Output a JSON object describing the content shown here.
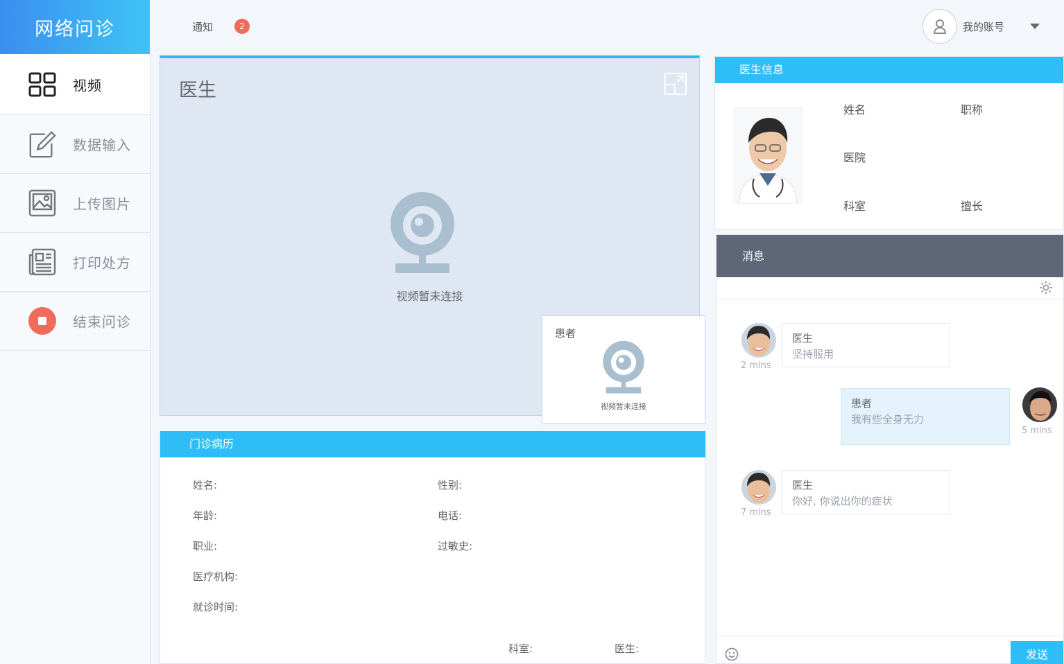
{
  "app": {
    "title": "网络问诊"
  },
  "topbar": {
    "notice_label": "通知",
    "notice_count": "2",
    "account_label": "我的账号"
  },
  "sidebar": {
    "items": [
      {
        "label": "视频",
        "icon": "grid-icon"
      },
      {
        "label": "数据输入",
        "icon": "edit-icon"
      },
      {
        "label": "上传图片",
        "icon": "image-icon"
      },
      {
        "label": "打印处方",
        "icon": "newspaper-icon"
      },
      {
        "label": "结束问诊",
        "icon": "stop-icon"
      }
    ]
  },
  "video": {
    "main_title": "医生",
    "main_status": "视频暂未连接",
    "small_title": "患者",
    "small_status": "视频暂未连接"
  },
  "record": {
    "title": "门诊病历",
    "name_label": "姓名:",
    "gender_label": "性别:",
    "age_label": "年龄:",
    "phone_label": "电话:",
    "job_label": "职业:",
    "allergy_label": "过敏史:",
    "org_label": "医疗机构:",
    "time_label": "就诊时间:",
    "dept_label": "科室:",
    "doctor_label": "医生:"
  },
  "doctor_info": {
    "title": "医生信息",
    "name_label": "姓名",
    "title_label": "职称",
    "hospital_label": "医院",
    "dept_label": "科室",
    "specialty_label": "擅长"
  },
  "messages": {
    "title": "消息",
    "send_label": "发送",
    "items": [
      {
        "sender": "医生",
        "text": "坚持服用",
        "time": "2 mins"
      },
      {
        "sender": "患者",
        "text": "我有些全身无力",
        "time": "5 mins"
      },
      {
        "sender": "医生",
        "text": "你好, 你说出你的症状",
        "time": "7 mins"
      }
    ]
  },
  "colors": {
    "accent": "#2fbdf7",
    "badge": "#ef6b5c",
    "stop": "#ef6b5c",
    "msg_header": "#5e6778"
  }
}
